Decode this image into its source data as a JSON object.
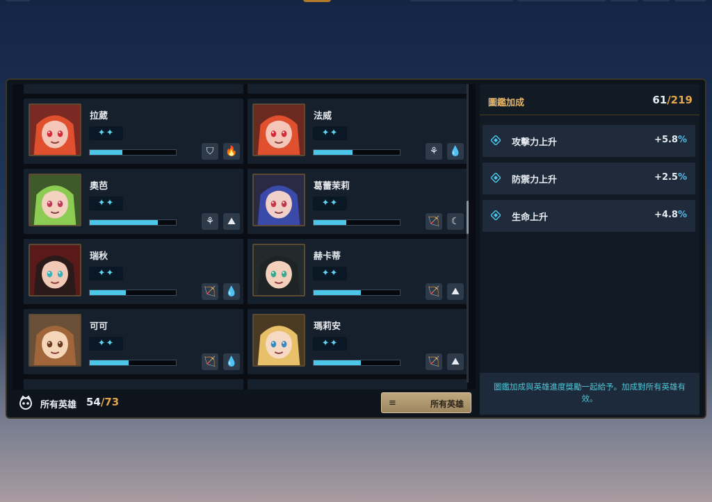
{
  "heroes": [
    {
      "name": "拉葳",
      "stars": "✦✦",
      "progress": 0.38,
      "icons": [
        "shield-icon",
        "fire-icon"
      ],
      "icon_glyphs": [
        "⛉",
        "🔥"
      ]
    },
    {
      "name": "法威",
      "stars": "✦✦",
      "progress": 0.45,
      "icons": [
        "tree-icon",
        "water-drop-icon"
      ],
      "icon_glyphs": [
        "⚘",
        "💧"
      ]
    },
    {
      "name": "奧芭",
      "stars": "✦✦",
      "progress": 0.79,
      "icons": [
        "tree-icon",
        "mountain-icon"
      ],
      "icon_glyphs": [
        "⚘",
        "⛰"
      ]
    },
    {
      "name": "葛蕾茉莉",
      "stars": "✦✦",
      "progress": 0.38,
      "icons": [
        "bow-icon",
        "moon-icon"
      ],
      "icon_glyphs": [
        "🏹",
        "☾"
      ]
    },
    {
      "name": "瑞秋",
      "stars": "✦✦",
      "progress": 0.42,
      "icons": [
        "bow-icon",
        "water-drop-icon"
      ],
      "icon_glyphs": [
        "🏹",
        "💧"
      ]
    },
    {
      "name": "赫卡蒂",
      "stars": "✦✦",
      "progress": 0.55,
      "icons": [
        "bow-icon",
        "mountain-icon"
      ],
      "icon_glyphs": [
        "🏹",
        "⛰"
      ]
    },
    {
      "name": "可可",
      "stars": "✦✦",
      "progress": 0.45,
      "icons": [
        "bow-icon",
        "water-drop-icon"
      ],
      "icon_glyphs": [
        "🏹",
        "💧"
      ]
    },
    {
      "name": "瑪莉安",
      "stars": "✦✦",
      "progress": 0.55,
      "icons": [
        "bow-icon",
        "mountain-icon"
      ],
      "icon_glyphs": [
        "🏹",
        "⛰"
      ]
    }
  ],
  "footer": {
    "label": "所有英雄",
    "count": "54",
    "total": "/73",
    "filter_label": "所有英雄",
    "filter_icon": "≡"
  },
  "codex": {
    "title": "圖鑑加成",
    "count": "61",
    "total": "/219",
    "bonuses": [
      {
        "name": "攻擊力上升",
        "value": "+5.8",
        "unit": "%"
      },
      {
        "name": "防禦力上升",
        "value": "+2.5",
        "unit": "%"
      },
      {
        "name": "生命上升",
        "value": "+4.8",
        "unit": "%"
      }
    ],
    "note": "圖鑑加成與英雄進度獎勵一起給予。加成對所有英雄有效。"
  },
  "colors": {
    "accent": "#4cc7ea",
    "gold": "#e3a64a",
    "percent": "#56b8e6"
  }
}
